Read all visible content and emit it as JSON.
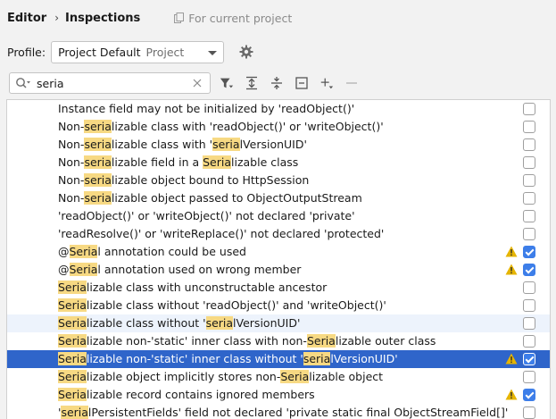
{
  "breadcrumb": {
    "parent": "Editor",
    "current": "Inspections",
    "scope": "For current project"
  },
  "profile": {
    "label": "Profile:",
    "name": "Project Default",
    "kind": "Project"
  },
  "search": {
    "value": "seria"
  },
  "colors": {
    "highlight": "#f7d983",
    "selection": "#2f65ca",
    "checkbox_on": "#3d7ee9",
    "warning": "#e5b400"
  },
  "inspections": [
    {
      "parts": [
        {
          "t": "Instance field may not be initialized by 'readObject()'",
          "h": false
        }
      ],
      "warning": false,
      "checked": false,
      "state": "normal"
    },
    {
      "parts": [
        {
          "t": "Non-",
          "h": false
        },
        {
          "t": "seria",
          "h": true
        },
        {
          "t": "lizable class with 'readObject()' or 'writeObject()'",
          "h": false
        }
      ],
      "warning": false,
      "checked": false,
      "state": "normal"
    },
    {
      "parts": [
        {
          "t": "Non-",
          "h": false
        },
        {
          "t": "seria",
          "h": true
        },
        {
          "t": "lizable class with '",
          "h": false
        },
        {
          "t": "seria",
          "h": true
        },
        {
          "t": "lVersionUID'",
          "h": false
        }
      ],
      "warning": false,
      "checked": false,
      "state": "normal"
    },
    {
      "parts": [
        {
          "t": "Non-",
          "h": false
        },
        {
          "t": "seria",
          "h": true
        },
        {
          "t": "lizable field in a ",
          "h": false
        },
        {
          "t": "Seria",
          "h": true
        },
        {
          "t": "lizable class",
          "h": false
        }
      ],
      "warning": false,
      "checked": false,
      "state": "normal"
    },
    {
      "parts": [
        {
          "t": "Non-",
          "h": false
        },
        {
          "t": "seria",
          "h": true
        },
        {
          "t": "lizable object bound to HttpSession",
          "h": false
        }
      ],
      "warning": false,
      "checked": false,
      "state": "normal"
    },
    {
      "parts": [
        {
          "t": "Non-",
          "h": false
        },
        {
          "t": "seria",
          "h": true
        },
        {
          "t": "lizable object passed to ObjectOutputStream",
          "h": false
        }
      ],
      "warning": false,
      "checked": false,
      "state": "normal"
    },
    {
      "parts": [
        {
          "t": "'readObject()' or 'writeObject()' not declared 'private'",
          "h": false
        }
      ],
      "warning": false,
      "checked": false,
      "state": "normal"
    },
    {
      "parts": [
        {
          "t": "'readResolve()' or 'writeReplace()' not declared 'protected'",
          "h": false
        }
      ],
      "warning": false,
      "checked": false,
      "state": "normal"
    },
    {
      "parts": [
        {
          "t": "@",
          "h": false
        },
        {
          "t": "Seria",
          "h": true
        },
        {
          "t": "l annotation could be used",
          "h": false
        }
      ],
      "warning": true,
      "checked": true,
      "state": "normal"
    },
    {
      "parts": [
        {
          "t": "@",
          "h": false
        },
        {
          "t": "Seria",
          "h": true
        },
        {
          "t": "l annotation used on wrong member",
          "h": false
        }
      ],
      "warning": true,
      "checked": true,
      "state": "normal"
    },
    {
      "parts": [
        {
          "t": "Seria",
          "h": true
        },
        {
          "t": "lizable class with unconstructable ancestor",
          "h": false
        }
      ],
      "warning": false,
      "checked": false,
      "state": "normal"
    },
    {
      "parts": [
        {
          "t": "Seria",
          "h": true
        },
        {
          "t": "lizable class without 'readObject()' and 'writeObject()'",
          "h": false
        }
      ],
      "warning": false,
      "checked": false,
      "state": "normal"
    },
    {
      "parts": [
        {
          "t": "Seria",
          "h": true
        },
        {
          "t": "lizable class without '",
          "h": false
        },
        {
          "t": "seria",
          "h": true
        },
        {
          "t": "lVersionUID'",
          "h": false
        }
      ],
      "warning": false,
      "checked": false,
      "state": "hover"
    },
    {
      "parts": [
        {
          "t": "Seria",
          "h": true
        },
        {
          "t": "lizable non-'static' inner class with non-",
          "h": false
        },
        {
          "t": "Seria",
          "h": true
        },
        {
          "t": "lizable outer class",
          "h": false
        }
      ],
      "warning": false,
      "checked": false,
      "state": "normal"
    },
    {
      "parts": [
        {
          "t": "Seria",
          "h": true
        },
        {
          "t": "lizable non-'static' inner class without '",
          "h": false
        },
        {
          "t": "seria",
          "h": true
        },
        {
          "t": "lVersionUID'",
          "h": false
        }
      ],
      "warning": true,
      "checked": true,
      "state": "selected"
    },
    {
      "parts": [
        {
          "t": "Seria",
          "h": true
        },
        {
          "t": "lizable object implicitly stores non-",
          "h": false
        },
        {
          "t": "Seria",
          "h": true
        },
        {
          "t": "lizable object",
          "h": false
        }
      ],
      "warning": false,
      "checked": false,
      "state": "normal"
    },
    {
      "parts": [
        {
          "t": "Seria",
          "h": true
        },
        {
          "t": "lizable record contains ignored members",
          "h": false
        }
      ],
      "warning": true,
      "checked": true,
      "state": "normal"
    },
    {
      "parts": [
        {
          "t": "'",
          "h": false
        },
        {
          "t": "seria",
          "h": true
        },
        {
          "t": "lPersistentFields' field not declared 'private static final ObjectStreamField[]'",
          "h": false
        }
      ],
      "warning": false,
      "checked": false,
      "state": "normal"
    }
  ]
}
